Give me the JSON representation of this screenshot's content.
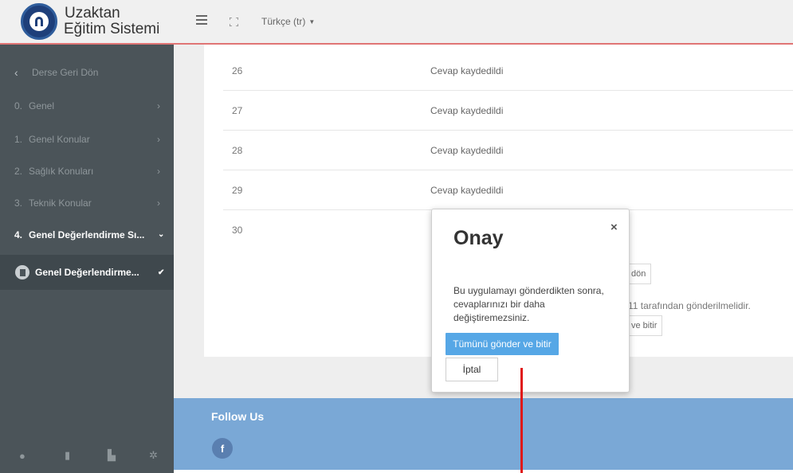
{
  "header": {
    "brand_line1": "Uzaktan",
    "brand_line2": "Eğitim Sistemi",
    "language": "Türkçe (tr)"
  },
  "sidebar": {
    "back_label": "Derse Geri Dön",
    "items": [
      {
        "num": "0.",
        "label": "Genel"
      },
      {
        "num": "1.",
        "label": "Genel Konular"
      },
      {
        "num": "2.",
        "label": "Sağlık Konuları"
      },
      {
        "num": "3.",
        "label": "Teknik Konular"
      },
      {
        "num": "4.",
        "label": "Genel Değerlendirme Sı..."
      }
    ],
    "current_activity": "Genel Değerlendirme..."
  },
  "rows": [
    {
      "num": "26",
      "status": "Cevap kaydedildi"
    },
    {
      "num": "27",
      "status": "Cevap kaydedildi"
    },
    {
      "num": "28",
      "status": "Cevap kaydedildi"
    },
    {
      "num": "29",
      "status": "Cevap kaydedildi"
    },
    {
      "num": "30",
      "status": ""
    }
  ],
  "background_partial": {
    "return_button_fragment": "dön",
    "info_fragment": "11 tarafından gönderilmelidir.",
    "finish_button_fragment": "ve bitir"
  },
  "footer": {
    "title": "Follow Us",
    "facebook_glyph": "f"
  },
  "modal": {
    "title": "Onay",
    "close": "×",
    "body": "Bu uygulamayı gönderdikten sonra, cevaplarınızı bir daha değiştiremezsiniz.",
    "submit_label": "Tümünü gönder ve bitir",
    "cancel_label": "İptal"
  },
  "colors": {
    "header_bg": "#f0f0f0",
    "header_border": "#e07575",
    "sidebar_bg": "#4b5459",
    "footer_bg": "#7aa8d6",
    "primary_button": "#56a7e6",
    "annotation_red": "#e01818"
  }
}
